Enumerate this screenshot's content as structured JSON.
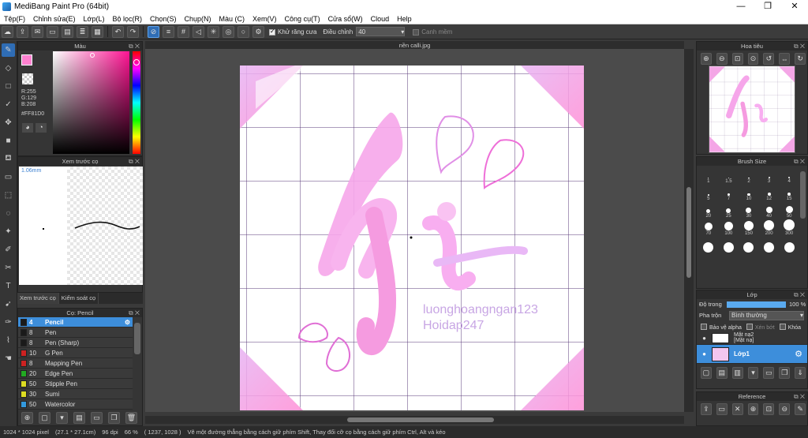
{
  "window": {
    "title": "MediBang Paint Pro (64bit)",
    "controls": [
      "—",
      "❐",
      "✕"
    ]
  },
  "menu": [
    "Tệp(F)",
    "Chỉnh sửa(E)",
    "Lớp(L)",
    "Bộ lọc(R)",
    "Chọn(S)",
    "Chụp(N)",
    "Màu (C)",
    "Xem(V)",
    "Công cụ(T)",
    "Cửa sổ(W)",
    "Cloud",
    "Help"
  ],
  "toolbar": {
    "antialias_label": "Khử răng cưa",
    "correction_label": "Điều chỉnh",
    "correction_value": "40",
    "snap_label": "Canh mềm"
  },
  "panels": {
    "color_title": "Màu",
    "color_readout": {
      "r": "R:255",
      "g": "G:129",
      "b": "B:208",
      "hex": "#FF81D0"
    },
    "preview_title": "Xem trước cọ",
    "preview_size": "1.06mm",
    "preview_tabs": [
      "Xem trước cọ",
      "Kiểm soát cọ"
    ],
    "brush_title": "Cọ: Pencil",
    "brushes": [
      {
        "size": "4",
        "name": "Pencil",
        "color": "#1a1a1a",
        "selected": true
      },
      {
        "size": "8",
        "name": "Pen",
        "color": "#1a1a1a",
        "selected": false
      },
      {
        "size": "8",
        "name": "Pen (Sharp)",
        "color": "#1a1a1a",
        "selected": false
      },
      {
        "size": "10",
        "name": "G Pen",
        "color": "#cc2222",
        "selected": false
      },
      {
        "size": "8",
        "name": "Mapping Pen",
        "color": "#cc2222",
        "selected": false
      },
      {
        "size": "20",
        "name": "Edge Pen",
        "color": "#22aa22",
        "selected": false
      },
      {
        "size": "50",
        "name": "Stipple Pen",
        "color": "#dddd22",
        "selected": false
      },
      {
        "size": "30",
        "name": "Sumi",
        "color": "#dddd22",
        "selected": false
      },
      {
        "size": "50",
        "name": "Watercolor",
        "color": "#3399dd",
        "selected": false
      }
    ],
    "navigator_title": "Hoa tiêu",
    "brush_size_title": "Brush Size",
    "brush_sizes": [
      "1",
      "1.5",
      "2",
      "3",
      "4",
      "5",
      "7",
      "10",
      "12",
      "15",
      "20",
      "25",
      "30",
      "40",
      "50",
      "70",
      "100",
      "150",
      "200",
      "300",
      "",
      "",
      "",
      "",
      ""
    ],
    "layer_title": "Lớp",
    "opacity_label": "Độ trong",
    "opacity_value": "100 %",
    "opacity_fraction": 1.0,
    "blend_label": "Pha trộn",
    "blend_value": "Bình thường",
    "protect_alpha": "Bảo vệ alpha",
    "clipping": "Xén bớt",
    "lock": "Khóa",
    "layers": [
      {
        "name": "Mặt nạ2",
        "sub": "[Mặt nạ]",
        "selected": false
      },
      {
        "name": "Lớp1",
        "sub": "",
        "selected": true
      }
    ],
    "reference_title": "Reference"
  },
  "document": {
    "tab_title": "nền calli.jpg",
    "watermark_line1": "luonghoangngan123",
    "watermark_line2": "Hoidap247"
  },
  "status": {
    "size": "1024 * 1024 pixel",
    "physical": "(27.1 * 27.1cm)",
    "dpi": "96 dpi",
    "zoom": "66 %",
    "cursor": "( 1237, 1028 )",
    "hint": "Vẽ một đường thẳng bằng cách giữ phím Shift, Thay đổi cỡ cọ bằng cách giữ phím Ctrl, Alt và kéo"
  }
}
